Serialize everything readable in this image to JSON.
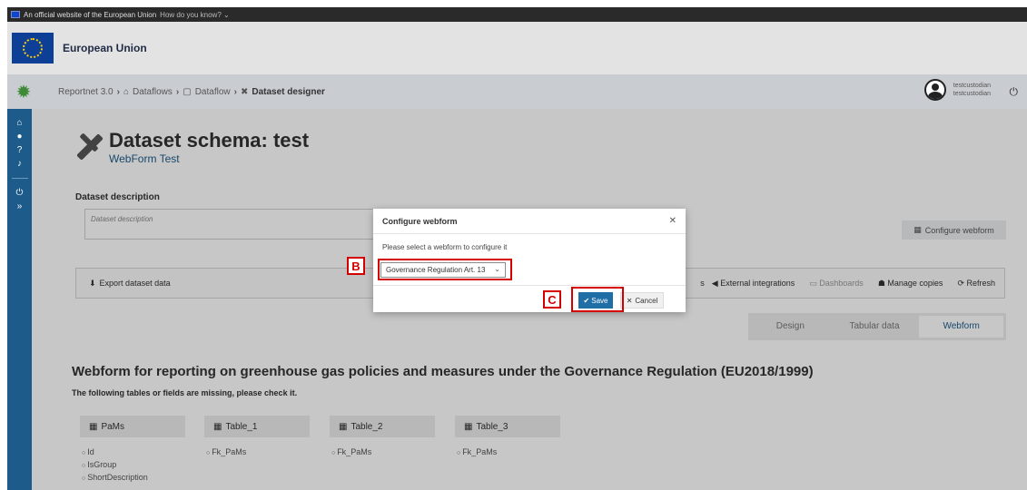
{
  "eu_banner": {
    "official_text": "An official website of the European Union",
    "how_know": "How do you know?",
    "org_name": "European Union"
  },
  "appbar": {
    "breadcrumbs": [
      "Reportnet 3.0",
      "Dataflows",
      "Dataflow",
      "Dataset designer"
    ],
    "user_line1": "testcustodian",
    "user_line2": "testcustodian"
  },
  "page": {
    "title": "Dataset schema: test",
    "subtitle": "WebForm Test",
    "description_label": "Dataset description",
    "description_placeholder": "Dataset description",
    "configure_webform": "Configure webform"
  },
  "toolbar": {
    "export": "Export dataset data",
    "external_integrations": "External integrations",
    "dashboards": "Dashboards",
    "manage_copies": "Manage copies",
    "refresh": "Refresh",
    "partial_s": "s"
  },
  "view_tabs": [
    "Design",
    "Tabular data",
    "Webform"
  ],
  "webform": {
    "heading": "Webform for reporting on greenhouse gas policies and measures under the Governance Regulation (EU2018/1999)",
    "missing_notice": "The following tables or fields are missing, please check it.",
    "tables": [
      {
        "name": "PaMs",
        "fields": [
          "Id",
          "IsGroup",
          "ShortDescription"
        ]
      },
      {
        "name": "Table_1",
        "fields": [
          "Fk_PaMs"
        ]
      },
      {
        "name": "Table_2",
        "fields": [
          "Fk_PaMs"
        ]
      },
      {
        "name": "Table_3",
        "fields": [
          "Fk_PaMs"
        ]
      }
    ]
  },
  "dialog": {
    "title": "Configure webform",
    "prompt": "Please select a webform to configure it",
    "selected": "Governance Regulation Art. 13",
    "save": "Save",
    "cancel": "Cancel"
  },
  "annotations": {
    "b": "B",
    "c": "C"
  },
  "colors": {
    "accent": "#1d5c8a",
    "annotation": "#d40000",
    "save_button": "#1f6ea6"
  }
}
